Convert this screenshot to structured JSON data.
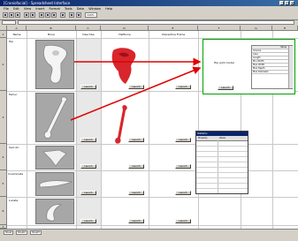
{
  "window": {
    "title": "[Craniofacial] - Spreadsheet Interface",
    "buttons": [
      "_",
      "□",
      "×"
    ]
  },
  "menu": [
    "File",
    "Edit",
    "View",
    "Insert",
    "Format",
    "Tools",
    "Data",
    "Window",
    "Help"
  ],
  "toolbar": {
    "zoom": "100%"
  },
  "columns": [
    "A",
    "B",
    "C",
    "D",
    "E",
    "F",
    "G",
    "H"
  ],
  "rows": [
    "1",
    "2",
    "3",
    "4",
    "5",
    "6",
    "7"
  ],
  "header": {
    "a": "Name",
    "b": "Bone",
    "c": "Describe",
    "d": "Halfbone",
    "e": "Interactive Frame"
  },
  "rows_data": [
    {
      "name": "Hip",
      "launch": "Launch"
    },
    {
      "name": "Femur",
      "launch": "Launch"
    },
    {
      "name": "Sacrum",
      "launch": "Launch"
    },
    {
      "name": "Innominate",
      "launch": "Launch"
    },
    {
      "name": "Lunate",
      "launch": "Launch"
    }
  ],
  "panel": {
    "title": "Hip joint model",
    "button": "Launch",
    "table_header": "Value",
    "table_rows": [
      "Volume",
      "Area",
      "Length",
      "Min Width",
      "Max Width",
      "Max Depth",
      "Max Diameter"
    ]
  },
  "popup": {
    "title": "Statistics",
    "columns": [
      "Property",
      "Value"
    ]
  },
  "tabs": [
    "Sheet",
    "Sheet2",
    "Sheet3"
  ]
}
